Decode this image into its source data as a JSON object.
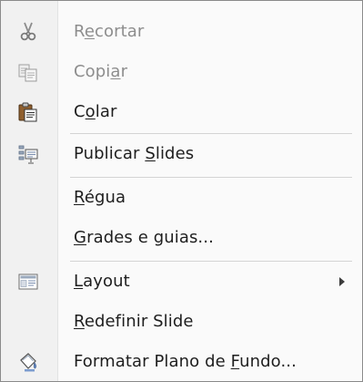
{
  "menu": {
    "items": [
      {
        "pre": "R",
        "key": "e",
        "post": "cortar",
        "icon": "scissors-icon",
        "enabled": false
      },
      {
        "pre": "Copi",
        "key": "a",
        "post": "r",
        "icon": "copy-icon",
        "enabled": false
      },
      {
        "pre": "C",
        "key": "o",
        "post": "lar",
        "icon": "paste-icon",
        "enabled": true
      },
      {
        "pre": "Publicar ",
        "key": "S",
        "post": "lides",
        "icon": "publish-slides-icon",
        "enabled": true
      },
      {
        "pre": "",
        "key": "R",
        "post": "égua",
        "icon": "",
        "enabled": true
      },
      {
        "pre": "",
        "key": "G",
        "post": "rades e guias...",
        "icon": "",
        "enabled": true
      },
      {
        "pre": "",
        "key": "L",
        "post": "ayout",
        "icon": "layout-icon",
        "enabled": true,
        "submenu": true
      },
      {
        "pre": "",
        "key": "R",
        "post": "edefinir Slide",
        "icon": "",
        "enabled": true
      },
      {
        "pre": "Formatar Plano de ",
        "key": "F",
        "post": "undo...",
        "icon": "format-background-icon",
        "enabled": true
      }
    ]
  }
}
